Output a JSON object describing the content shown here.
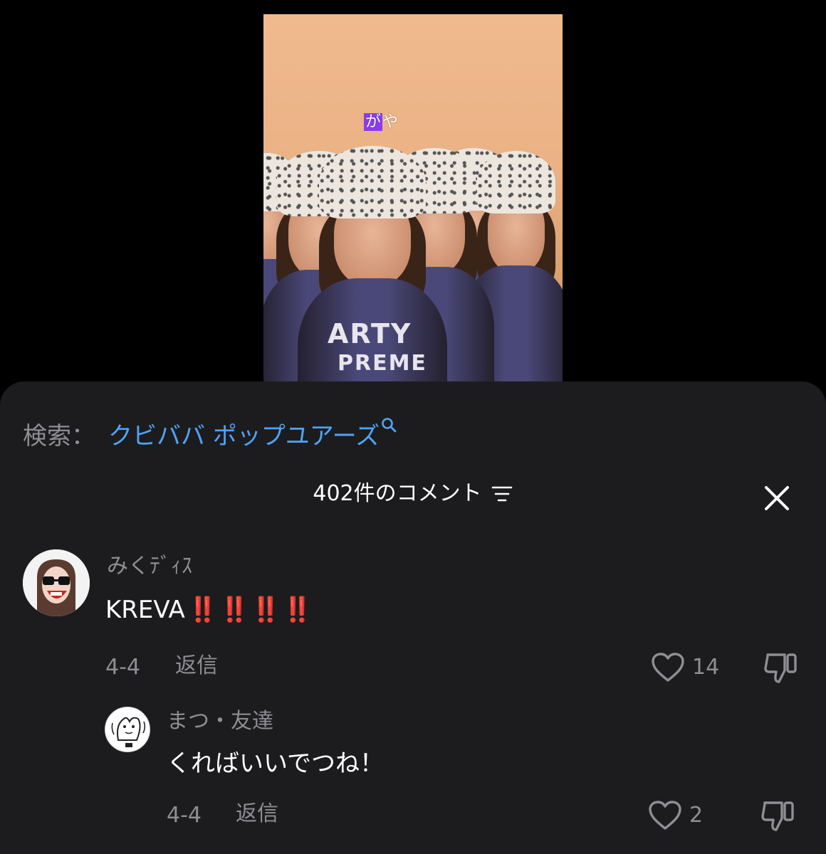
{
  "video": {
    "caption_highlight": "が",
    "caption_rest": "や",
    "jacket_line1": "ARTY",
    "jacket_line2": "PREME"
  },
  "search": {
    "label": "検索：",
    "term": "クビババ ポップユアーズ"
  },
  "header": {
    "title": "402件のコメント"
  },
  "comments": [
    {
      "username": "みくﾃﾞｨｽ",
      "text": "KREVA",
      "emoji": "‼️‼️‼️‼️",
      "date": "4-4",
      "reply_label": "返信",
      "likes": "14"
    },
    {
      "username": "まつ・友達",
      "text": "くればいいでつね！",
      "date": "4-4",
      "reply_label": "返信",
      "likes": "2"
    }
  ],
  "colors": {
    "sheet_bg": "#1c1c1e",
    "link_blue": "#4fa3f7",
    "muted_gray": "#8e8e93",
    "caption_highlight": "#8b3cf0"
  }
}
